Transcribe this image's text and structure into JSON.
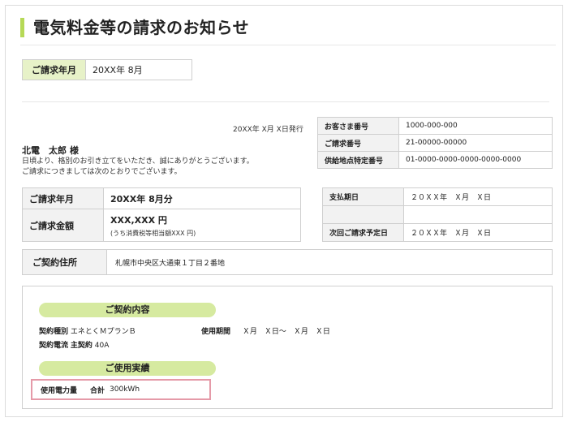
{
  "page_title": "電気料金等の請求のお知らせ",
  "billing_month_box": {
    "label": "ご請求年月",
    "value": "20XX年 8月"
  },
  "issue_date": "20XX年 X月 X日発行",
  "customer_name": "北電　太郎 様",
  "greeting": {
    "line1": "日頃より、格別のお引き立てをいただき、誠にありがとうございます。",
    "line2": "ご請求につきましては次のとおりでございます。"
  },
  "customer_info": {
    "customer_number_label": "お客さま番号",
    "customer_number": "1000-000-000",
    "billing_number_label": "ご請求番号",
    "billing_number": "21-00000-00000",
    "supply_point_label": "供給地点特定番号",
    "supply_point": "01-0000-0000-0000-0000-0000"
  },
  "summary": {
    "month_label": "ご請求年月",
    "month_value": "20XX年 8月分",
    "amount_label": "ご請求金額",
    "amount_value": "XXX,XXX 円",
    "amount_tax": "(うち消費税等相当額XXX 円)"
  },
  "payment": {
    "due_label": "支払期日",
    "due_value": "２０ＸＸ年　Ｘ月　Ｘ日",
    "next_label": "次回ご請求予定日",
    "next_value": "２０ＸＸ年　Ｘ月　Ｘ日"
  },
  "address": {
    "label": "ご契約住所",
    "value": "札幌市中央区大通東１丁目２番地"
  },
  "contract": {
    "section_title": "ご契約内容",
    "type_label": "契約種別",
    "type_value": "エネとくＭプランＢ",
    "period_label": "使用期間",
    "period_value": "Ｘ月　Ｘ日～　Ｘ月　Ｘ日",
    "current_label": "契約電流",
    "current_sublabel": "主契約",
    "current_value": "40A"
  },
  "usage": {
    "section_title": "ご使用実績",
    "label": "使用電力量",
    "total_label": "合計",
    "total_value": "300kWh"
  },
  "colors": {
    "accent_green": "#b6d957",
    "pill_green": "#d6eaa0",
    "label_green": "#e7f2c8",
    "highlight_pink": "#e59aa8"
  }
}
